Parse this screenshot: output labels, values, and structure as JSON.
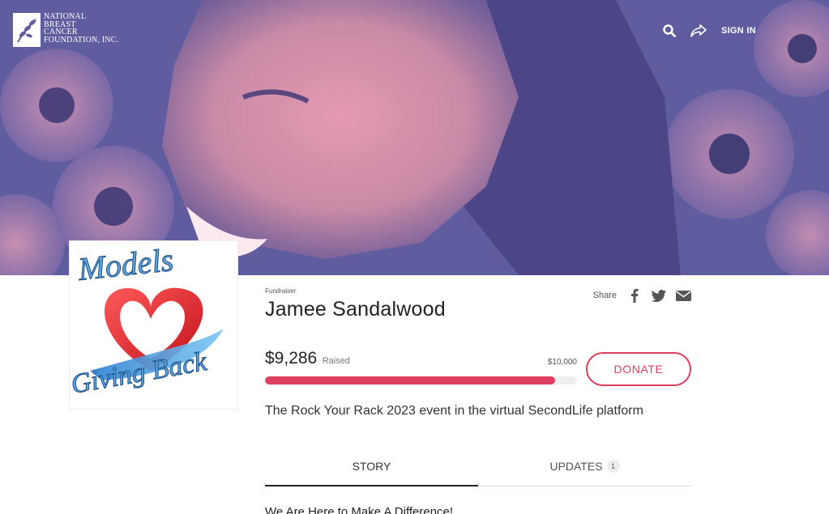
{
  "org": {
    "logo_lines": [
      "NATIONAL",
      "BREAST",
      "CANCER",
      "FOUNDATION, INC."
    ]
  },
  "nav": {
    "sign_in": "SIGN IN",
    "search_icon": "search-icon",
    "share_icon": "share-arrow-icon"
  },
  "campaign": {
    "image_text_top": "Models",
    "image_text_bottom": "Giving Back"
  },
  "fundraiser": {
    "eyebrow": "Fundraiser",
    "name": "Jamee Sandalwood",
    "share_label": "Share",
    "share_icons": [
      "facebook-icon",
      "twitter-icon",
      "email-icon"
    ]
  },
  "progress": {
    "raised": "$9,286",
    "raised_label": "Raised",
    "goal": "$10,000",
    "fraction": 0.9286,
    "accent_color": "#e0405f"
  },
  "donate_label": "DONATE",
  "description": "The Rock Your Rack 2023 event in the virtual SecondLife platform",
  "tabs": [
    {
      "label": "STORY",
      "active": true
    },
    {
      "label": "UPDATES",
      "count": "1",
      "active": false
    }
  ],
  "story_heading": "We Are Here to Make A Difference!"
}
